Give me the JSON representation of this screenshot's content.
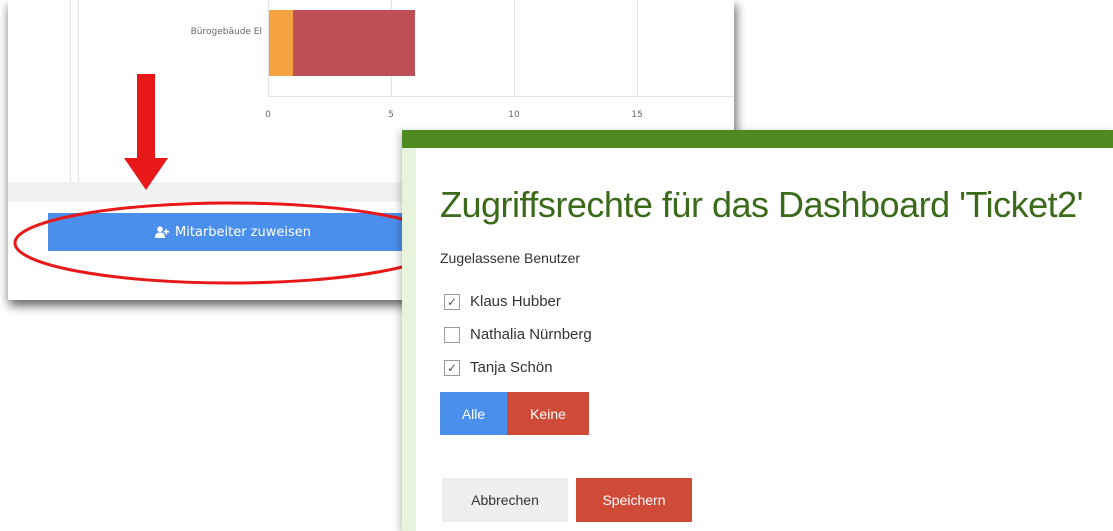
{
  "dashboard": {
    "category_label": "Bürogebäude El",
    "axis_ticks": [
      "0",
      "5",
      "10",
      "15"
    ],
    "bar_segments": [
      {
        "color": "#f5a342",
        "value": 1
      },
      {
        "color": "#bf4f56",
        "value": 5
      }
    ],
    "assign_button_label": "Mitarbeiter zuweisen"
  },
  "modal": {
    "title": "Zugriffsrechte für das Dashboard 'Ticket2'",
    "section_label": "Zugelassene Benutzer",
    "users": [
      {
        "name": "Klaus Hubber",
        "checked": true
      },
      {
        "name": "Nathalia Nürnberg",
        "checked": false
      },
      {
        "name": "Tanja Schön",
        "checked": true
      }
    ],
    "all_label": "Alle",
    "none_label": "Keine",
    "cancel_label": "Abbrechen",
    "save_label": "Speichern"
  },
  "colors": {
    "modal_accent": "#4e8a1f",
    "primary_blue": "#4a8fec",
    "danger_red": "#d04a38",
    "annotation_red": "#e81818"
  }
}
